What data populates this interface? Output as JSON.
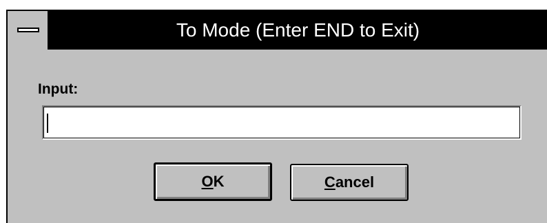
{
  "window": {
    "title": "To Mode (Enter END to Exit)"
  },
  "form": {
    "input_label": "Input:",
    "input_value": ""
  },
  "buttons": {
    "ok_label": "OK",
    "ok_mnemonic": "O",
    "ok_rest": "K",
    "cancel_label": "Cancel",
    "cancel_mnemonic": "C",
    "cancel_rest": "ancel"
  },
  "icons": {
    "system_menu": "system-menu-icon"
  },
  "colors": {
    "title_bar": "#000000",
    "title_text": "#ffffff",
    "dialog_face": "#c0c0c0"
  }
}
